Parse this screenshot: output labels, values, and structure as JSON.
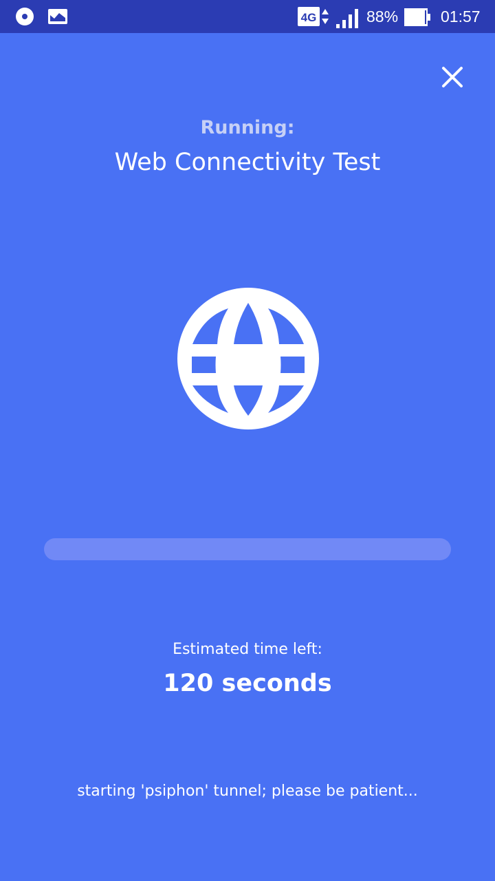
{
  "status_bar": {
    "network_type": "4G",
    "battery_percent": "88%",
    "time": "01:57",
    "left_icons": [
      "record-icon",
      "image-icon"
    ],
    "background_color": "#2b3cb3"
  },
  "screen": {
    "background_color": "#4971f4",
    "running_label": "Running:",
    "test_name": "Web Connectivity Test",
    "test_icon": "globe-icon",
    "close_icon": "close-icon",
    "progress": 0,
    "eta_label": "Estimated time left:",
    "eta_value": "120 seconds",
    "log_text": "starting 'psiphon' tunnel; please be patient..."
  }
}
